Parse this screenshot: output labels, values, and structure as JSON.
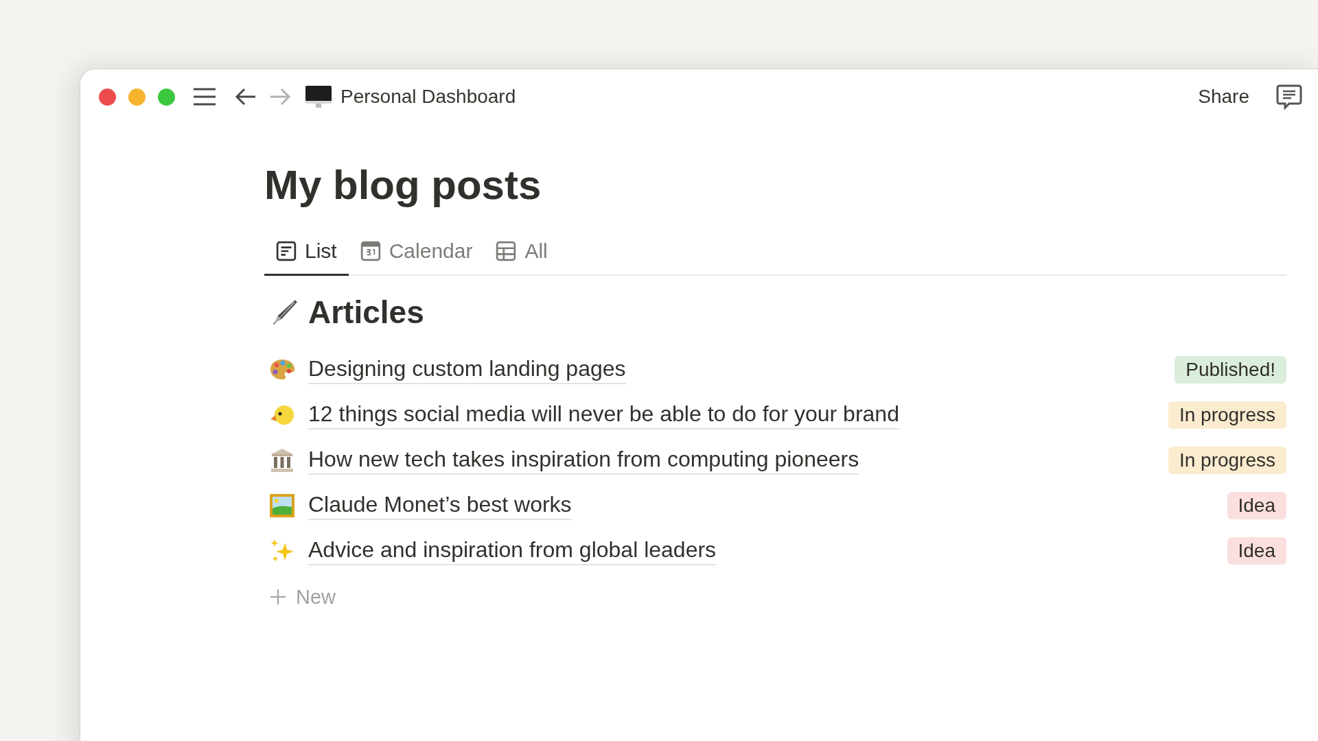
{
  "window": {
    "title": "Personal Dashboard",
    "share": "Share"
  },
  "page": {
    "title": "My blog posts"
  },
  "tabs": [
    {
      "label": "List",
      "selected": true
    },
    {
      "label": "Calendar",
      "selected": false
    },
    {
      "label": "All",
      "selected": false
    }
  ],
  "section": {
    "title": "Articles"
  },
  "rows": [
    {
      "title": "Designing custom landing pages",
      "status": {
        "label": "Published!",
        "color": "#dbeddb"
      }
    },
    {
      "title": "12 things social media will never be able to do for your brand",
      "status": {
        "label": "In progress",
        "color": "#fbecd0"
      }
    },
    {
      "title": "How new tech takes inspiration from computing pioneers",
      "status": {
        "label": "In progress",
        "color": "#fbecd0"
      }
    },
    {
      "title": "Claude Monet’s best works",
      "status": {
        "label": "Idea",
        "color": "#fbdfdf"
      }
    },
    {
      "title": "Advice and inspiration from global leaders",
      "status": {
        "label": "Idea",
        "color": "#fbdfdf"
      }
    }
  ],
  "new_button": {
    "label": "New"
  }
}
